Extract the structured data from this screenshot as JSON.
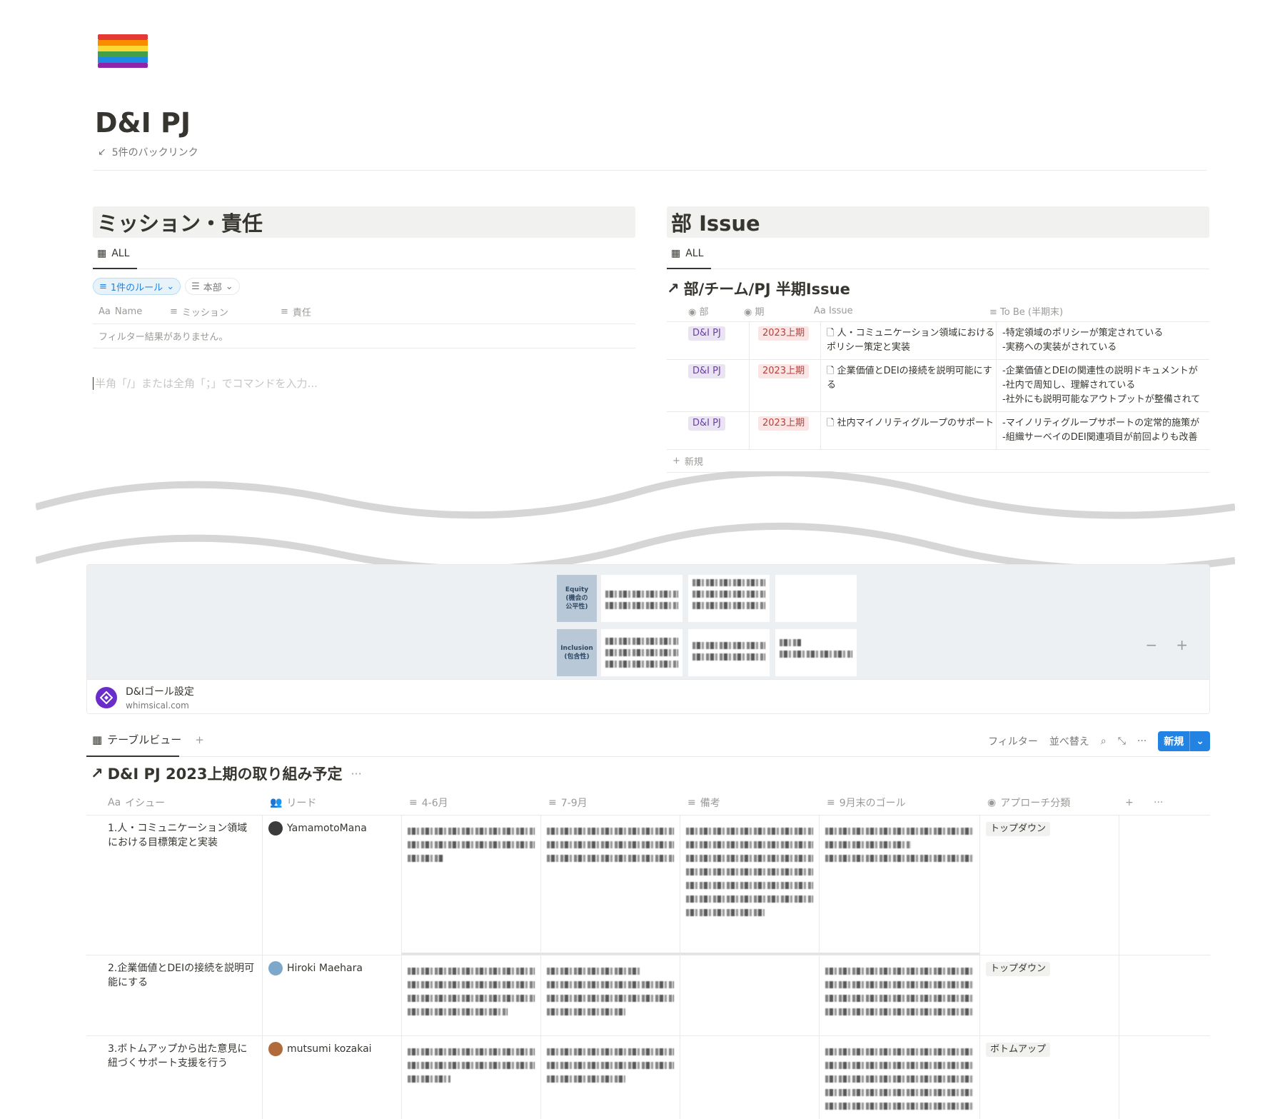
{
  "page": {
    "title": "D&I PJ",
    "backlinks": "5件のバックリンク",
    "icon": "rainbow-flag"
  },
  "mission": {
    "heading": "ミッション・責任",
    "view_tab": "ALL",
    "filter_rule": "1件のルール",
    "filter_dept": "本部",
    "columns": [
      "Name",
      "ミッション",
      "責任"
    ],
    "empty_message": "フィルター結果がありません。",
    "command_placeholder": "半角「/」または全角「；」でコマンドを入力..."
  },
  "issues": {
    "heading": "部 Issue",
    "view_tab": "ALL",
    "linked_title": "部/チーム/PJ 半期Issue",
    "columns": [
      "部",
      "期",
      "Issue",
      "To Be (半期末)"
    ],
    "rows": [
      {
        "dept": "D&I PJ",
        "period": "2023上期",
        "issue": "人・コミュニケーション領域におけるポリシー策定と実装",
        "tobe": [
          "-特定領域のポリシーが策定されている",
          "-実務への実装がされている"
        ]
      },
      {
        "dept": "D&I PJ",
        "period": "2023上期",
        "issue": "企業価値とDEIの接続を説明可能にする",
        "tobe": [
          "-企業価値とDEIの関連性の説明ドキュメントが",
          "-社内で周知し、理解されている",
          "-社外にも説明可能なアウトプットが整備されて"
        ]
      },
      {
        "dept": "D&I PJ",
        "period": "2023上期",
        "issue": "社内マイノリティグループのサポート",
        "tobe": [
          "-マイノリティグループサポートの定常的施策が",
          "-組織サーベイのDEI関連項目が前回よりも改善"
        ]
      }
    ],
    "new_label": "新規"
  },
  "embed": {
    "rows": [
      {
        "label": [
          "Equity",
          "(機会の",
          "公平性)"
        ]
      },
      {
        "label": [
          "Inclusion",
          "(包含性)"
        ]
      }
    ],
    "zoom_out": "−",
    "zoom_in": "+",
    "title": "D&Iゴール設定",
    "url": "whimsical.com"
  },
  "plan": {
    "view_tab": "テーブルビュー",
    "toolbar": {
      "filter": "フィルター",
      "sort": "並べ替え",
      "new": "新規"
    },
    "title": "D&I PJ 2023上期の取り組み予定",
    "columns": [
      "イシュー",
      "リード",
      "4-6月",
      "7-9月",
      "備考",
      "9月末のゴール",
      "アプローチ分類"
    ],
    "rows": [
      {
        "issue": "1.人・コミュニケーション領域における目標策定と実装",
        "lead": "YamamotoMana",
        "approach": "トップダウン"
      },
      {
        "issue": "2.企業価値とDEIの接続を説明可能にする",
        "lead": "Hiroki Maehara",
        "approach": "トップダウン"
      },
      {
        "issue": "3.ボトムアップから出た意見に紐づくサポート支援を行う",
        "lead": "mutsumi kozakai",
        "approach": "ボトムアップ"
      }
    ],
    "new_label": "新規"
  },
  "colors": {
    "accent": "#2383e2",
    "purple_tag": "#eae4f2",
    "red_tag": "#fbe4e4",
    "whimsical": "#6b2dc9"
  }
}
